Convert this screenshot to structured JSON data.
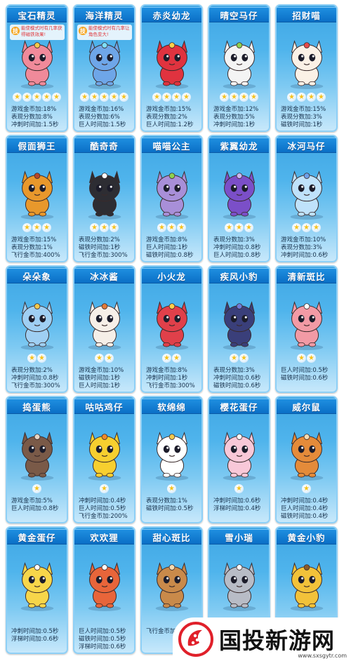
{
  "pets": [
    {
      "name": "宝石精灵",
      "stars": 5,
      "note": "能使模式时有几率获得磁铁效果!",
      "color": "#f08a9a",
      "accent": "#f2c94c",
      "stats": [
        "游戏金币加:18%",
        "表现分数加:8%",
        "冲刺时间加:1.5秒"
      ]
    },
    {
      "name": "海洋精灵",
      "stars": 5,
      "note": "能使模式时有几率让角色变大!",
      "color": "#6ea6e8",
      "accent": "#7fe0ff",
      "stats": [
        "游戏金币加:16%",
        "表现分数加:6%",
        "巨人时间加:1.5秒"
      ]
    },
    {
      "name": "赤炎幼龙",
      "stars": 4,
      "note": "",
      "color": "#e0333f",
      "accent": "#ffcf4a",
      "stats": [
        "游戏金币加:15%",
        "表现分数加:2%",
        "巨人时间加:1.2秒"
      ]
    },
    {
      "name": "晴空马仔",
      "stars": 4,
      "note": "",
      "color": "#f4f4f4",
      "accent": "#8fd14f",
      "stats": [
        "游戏金币加:12%",
        "表现分数加:5%",
        "冲刺时间加:1秒"
      ]
    },
    {
      "name": "招财喵",
      "stars": 4,
      "note": "",
      "color": "#fbf1e6",
      "accent": "#e44b4b",
      "stats": [
        "游戏金币加:15%",
        "表现分数加:3%",
        "磁铁时间加:1秒"
      ]
    },
    {
      "name": "假面狮王",
      "stars": 3,
      "note": "",
      "color": "#e8982c",
      "accent": "#b5472a",
      "stats": [
        "游戏金币加:15%",
        "表现分数加:1%",
        "飞行金币加:400%"
      ]
    },
    {
      "name": "酷奇奇",
      "stars": 3,
      "note": "",
      "color": "#2d2d33",
      "accent": "#ffffff",
      "stats": [
        "表现分数加:2%",
        "磁铁时间加:1秒",
        "飞行金币加:300%"
      ]
    },
    {
      "name": "喵喵公主",
      "stars": 3,
      "note": "",
      "color": "#a88fd8",
      "accent": "#8fd14f",
      "stats": [
        "游戏金币加:8%",
        "巨人时间加:1秒",
        "磁铁时间加:0.8秒"
      ]
    },
    {
      "name": "紫翼幼龙",
      "stars": 3,
      "note": "",
      "color": "#7b4fc8",
      "accent": "#c9b6f0",
      "stats": [
        "表现分数加:3%",
        "冲刺时间加:0.8秒",
        "巨人时间加:0.8秒"
      ]
    },
    {
      "name": "冰河马仔",
      "stars": 3,
      "note": "",
      "color": "#bfe2fb",
      "accent": "#6fa0e8",
      "stats": [
        "游戏金币加:10%",
        "表现分数加:3%",
        "冲刺时间加:0.6秒"
      ]
    },
    {
      "name": "朵朵象",
      "stars": 2,
      "note": "",
      "color": "#9fcff3",
      "accent": "#f2c94c",
      "stats": [
        "表现分数加:2%",
        "冲刺时间加:0.8秒",
        "飞行金币加:300%"
      ]
    },
    {
      "name": "冰冰酱",
      "stars": 2,
      "note": "",
      "color": "#f6efe8",
      "accent": "#e07b3a",
      "stats": [
        "游戏金币加:10%",
        "磁铁时间加:1秒",
        "巨人时间加:1秒"
      ]
    },
    {
      "name": "小火龙",
      "stars": 2,
      "note": "",
      "color": "#e0404a",
      "accent": "#ffcf4a",
      "stats": [
        "游戏金币加:8%",
        "冲刺时间加:1秒",
        "飞行金币加:300%"
      ]
    },
    {
      "name": "疾风小豹",
      "stars": 2,
      "note": "",
      "color": "#3a3f7a",
      "accent": "#6e7bd8",
      "stats": [
        "表现分数加:3%",
        "冲刺时间加:0.6秒",
        "磁铁时间加:0.6秒"
      ]
    },
    {
      "name": "清新斑比",
      "stars": 2,
      "note": "",
      "color": "#f29aa5",
      "accent": "#ffffff",
      "stats": [
        "巨人时间加:0.5秒",
        "磁铁时间加:0.6秒"
      ]
    },
    {
      "name": "捣蛋熊",
      "stars": 1,
      "note": "",
      "color": "#7a5a48",
      "accent": "#e7d6c4",
      "stats": [
        "游戏金币加:5%",
        "巨人时间加:0.8秒"
      ]
    },
    {
      "name": "咕咕鸡仔",
      "stars": 1,
      "note": "",
      "color": "#f7cf2f",
      "accent": "#f08a2a",
      "stats": [
        "冲刺时间加:0.4秒",
        "巨人时间加:0.5秒",
        "飞行金币加:200%"
      ]
    },
    {
      "name": "软绵绵",
      "stars": 1,
      "note": "",
      "color": "#ffffff",
      "accent": "#f2c94c",
      "stats": [
        "表现分数加:1%",
        "磁铁时间加:0.5秒"
      ]
    },
    {
      "name": "樱花蛋仔",
      "stars": 1,
      "note": "",
      "color": "#f8c8d8",
      "accent": "#ffffff",
      "stats": [
        "冲刺时间加:0.6秒",
        "浮梯时间加:0.4秒"
      ]
    },
    {
      "name": "威尔鼠",
      "stars": 1,
      "note": "",
      "color": "#e48b3a",
      "accent": "#f6dcb2",
      "stats": [
        "冲刺时间加:0.4秒",
        "巨人时间加:0.4秒",
        "磁铁时间加:0.4秒"
      ]
    },
    {
      "name": "黄金蛋仔",
      "stars": 0,
      "note": "",
      "color": "#f7d64a",
      "accent": "#ffffff",
      "stats": [
        "冲刺时间加:0.5秒",
        "浮梯时间加:0.6秒"
      ]
    },
    {
      "name": "欢欢狸",
      "stars": 0,
      "note": "",
      "color": "#e8653a",
      "accent": "#ffffff",
      "stats": [
        "巨人时间加:0.5秒",
        "磁铁时间加:0.5秒",
        "浮梯时间加:0.6秒"
      ]
    },
    {
      "name": "甜心斑比",
      "stars": 0,
      "note": "",
      "color": "#c98a4a",
      "accent": "#f6dcb2",
      "stats": [
        "飞行金币加"
      ]
    },
    {
      "name": "雪小瑞",
      "stars": 0,
      "note": "",
      "color": "#b8bcc6",
      "accent": "#ffffff",
      "stats": []
    },
    {
      "name": "黄金小豹",
      "stars": 0,
      "note": "",
      "color": "#f2c23a",
      "accent": "#8a5a2a",
      "stats": []
    }
  ],
  "watermark": {
    "brand": "国投新游网",
    "url": "www.sxsgytr.com",
    "logo_color": "#e0202a"
  }
}
